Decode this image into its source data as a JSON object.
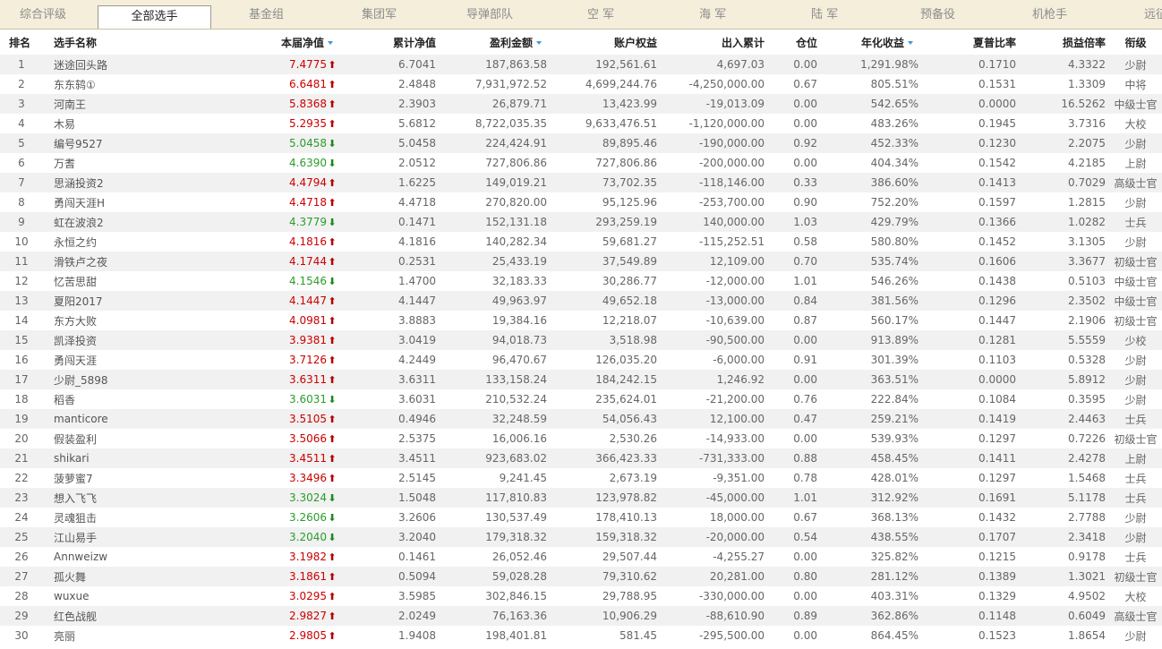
{
  "tabs": [
    "综合评级",
    "全部选手",
    "基金组",
    "集团军",
    "导弹部队",
    "空 军",
    "海 军",
    "陆 军",
    "预备役",
    "机枪手",
    "远征"
  ],
  "active_tab": 1,
  "headers": {
    "rank": "排名",
    "name": "选手名称",
    "nav": "本届净值",
    "cum_nav": "累计净值",
    "profit": "盈利金额",
    "equity": "账户权益",
    "flow": "出入累计",
    "position": "仓位",
    "annual": "年化收益",
    "sharpe": "夏普比率",
    "pl_ratio": "损益倍率",
    "grade": "衔级"
  },
  "colors": {
    "up": "#cc0000",
    "down": "#2a9d2a",
    "sort_indicator": "#3a9bd9",
    "row_alt": "#f1f1f1",
    "tabbar_bg": "#f4eedb"
  },
  "rows": [
    {
      "rank": "1",
      "name": "迷途回头路",
      "nav": "7.4775",
      "dir": "up",
      "cum_nav": "6.7041",
      "profit": "187,863.58",
      "equity": "192,561.61",
      "flow": "4,697.03",
      "position": "0.00",
      "annual": "1,291.98%",
      "sharpe": "0.1710",
      "pl_ratio": "4.3322",
      "grade": "少尉"
    },
    {
      "rank": "2",
      "name": "东东鸫①",
      "nav": "6.6481",
      "dir": "up",
      "cum_nav": "2.4848",
      "profit": "7,931,972.52",
      "equity": "4,699,244.76",
      "flow": "-4,250,000.00",
      "position": "0.67",
      "annual": "805.51%",
      "sharpe": "0.1531",
      "pl_ratio": "1.3309",
      "grade": "中将"
    },
    {
      "rank": "3",
      "name": "河南王",
      "nav": "5.8368",
      "dir": "up",
      "cum_nav": "2.3903",
      "profit": "26,879.71",
      "equity": "13,423.99",
      "flow": "-19,013.09",
      "position": "0.00",
      "annual": "542.65%",
      "sharpe": "0.0000",
      "pl_ratio": "16.5262",
      "grade": "中级士官"
    },
    {
      "rank": "4",
      "name": "木易",
      "nav": "5.2935",
      "dir": "up",
      "cum_nav": "5.6812",
      "profit": "8,722,035.35",
      "equity": "9,633,476.51",
      "flow": "-1,120,000.00",
      "position": "0.00",
      "annual": "483.26%",
      "sharpe": "0.1945",
      "pl_ratio": "3.7316",
      "grade": "大校"
    },
    {
      "rank": "5",
      "name": "编号9527",
      "nav": "5.0458",
      "dir": "down",
      "cum_nav": "5.0458",
      "profit": "224,424.91",
      "equity": "89,895.46",
      "flow": "-190,000.00",
      "position": "0.92",
      "annual": "452.33%",
      "sharpe": "0.1230",
      "pl_ratio": "2.2075",
      "grade": "少尉"
    },
    {
      "rank": "6",
      "name": "万耆",
      "nav": "4.6390",
      "dir": "down",
      "cum_nav": "2.0512",
      "profit": "727,806.86",
      "equity": "727,806.86",
      "flow": "-200,000.00",
      "position": "0.00",
      "annual": "404.34%",
      "sharpe": "0.1542",
      "pl_ratio": "4.2185",
      "grade": "上尉"
    },
    {
      "rank": "7",
      "name": "思涵投资2",
      "nav": "4.4794",
      "dir": "up",
      "cum_nav": "1.6225",
      "profit": "149,019.21",
      "equity": "73,702.35",
      "flow": "-118,146.00",
      "position": "0.33",
      "annual": "386.60%",
      "sharpe": "0.1413",
      "pl_ratio": "0.7029",
      "grade": "高级士官"
    },
    {
      "rank": "8",
      "name": "勇闯天涯H",
      "nav": "4.4718",
      "dir": "up",
      "cum_nav": "4.4718",
      "profit": "270,820.00",
      "equity": "95,125.96",
      "flow": "-253,700.00",
      "position": "0.90",
      "annual": "752.20%",
      "sharpe": "0.1597",
      "pl_ratio": "1.2815",
      "grade": "少尉"
    },
    {
      "rank": "9",
      "name": "虹在波浪2",
      "nav": "4.3779",
      "dir": "down",
      "cum_nav": "0.1471",
      "profit": "152,131.18",
      "equity": "293,259.19",
      "flow": "140,000.00",
      "position": "1.03",
      "annual": "429.79%",
      "sharpe": "0.1366",
      "pl_ratio": "1.0282",
      "grade": "士兵"
    },
    {
      "rank": "10",
      "name": "永恒之约",
      "nav": "4.1816",
      "dir": "up",
      "cum_nav": "4.1816",
      "profit": "140,282.34",
      "equity": "59,681.27",
      "flow": "-115,252.51",
      "position": "0.58",
      "annual": "580.80%",
      "sharpe": "0.1452",
      "pl_ratio": "3.1305",
      "grade": "少尉"
    },
    {
      "rank": "11",
      "name": "滑铁卢之夜",
      "nav": "4.1744",
      "dir": "up",
      "cum_nav": "0.2531",
      "profit": "25,433.19",
      "equity": "37,549.89",
      "flow": "12,109.00",
      "position": "0.70",
      "annual": "535.74%",
      "sharpe": "0.1606",
      "pl_ratio": "3.3677",
      "grade": "初级士官"
    },
    {
      "rank": "12",
      "name": "忆苦思甜",
      "nav": "4.1546",
      "dir": "down",
      "cum_nav": "1.4700",
      "profit": "32,183.33",
      "equity": "30,286.77",
      "flow": "-12,000.00",
      "position": "1.01",
      "annual": "546.26%",
      "sharpe": "0.1438",
      "pl_ratio": "0.5103",
      "grade": "中级士官"
    },
    {
      "rank": "13",
      "name": "夏阳2017",
      "nav": "4.1447",
      "dir": "up",
      "cum_nav": "4.1447",
      "profit": "49,963.97",
      "equity": "49,652.18",
      "flow": "-13,000.00",
      "position": "0.84",
      "annual": "381.56%",
      "sharpe": "0.1296",
      "pl_ratio": "2.3502",
      "grade": "中级士官"
    },
    {
      "rank": "14",
      "name": "东方大败",
      "nav": "4.0981",
      "dir": "up",
      "cum_nav": "3.8883",
      "profit": "19,384.16",
      "equity": "12,218.07",
      "flow": "-10,639.00",
      "position": "0.87",
      "annual": "560.17%",
      "sharpe": "0.1447",
      "pl_ratio": "2.1906",
      "grade": "初级士官"
    },
    {
      "rank": "15",
      "name": "凯泽投资",
      "nav": "3.9381",
      "dir": "up",
      "cum_nav": "3.0419",
      "profit": "94,018.73",
      "equity": "3,518.98",
      "flow": "-90,500.00",
      "position": "0.00",
      "annual": "913.89%",
      "sharpe": "0.1281",
      "pl_ratio": "5.5559",
      "grade": "少校"
    },
    {
      "rank": "16",
      "name": "勇闯天涯",
      "nav": "3.7126",
      "dir": "up",
      "cum_nav": "4.2449",
      "profit": "96,470.67",
      "equity": "126,035.20",
      "flow": "-6,000.00",
      "position": "0.91",
      "annual": "301.39%",
      "sharpe": "0.1103",
      "pl_ratio": "0.5328",
      "grade": "少尉"
    },
    {
      "rank": "17",
      "name": "少尉_5898",
      "nav": "3.6311",
      "dir": "up",
      "cum_nav": "3.6311",
      "profit": "133,158.24",
      "equity": "184,242.15",
      "flow": "1,246.92",
      "position": "0.00",
      "annual": "363.51%",
      "sharpe": "0.0000",
      "pl_ratio": "5.8912",
      "grade": "少尉"
    },
    {
      "rank": "18",
      "name": "稻香",
      "nav": "3.6031",
      "dir": "down",
      "cum_nav": "3.6031",
      "profit": "210,532.24",
      "equity": "235,624.01",
      "flow": "-21,200.00",
      "position": "0.76",
      "annual": "222.84%",
      "sharpe": "0.1084",
      "pl_ratio": "0.3595",
      "grade": "少尉"
    },
    {
      "rank": "19",
      "name": "manticore",
      "nav": "3.5105",
      "dir": "up",
      "cum_nav": "0.4946",
      "profit": "32,248.59",
      "equity": "54,056.43",
      "flow": "12,100.00",
      "position": "0.47",
      "annual": "259.21%",
      "sharpe": "0.1419",
      "pl_ratio": "2.4463",
      "grade": "士兵"
    },
    {
      "rank": "20",
      "name": "假装盈利",
      "nav": "3.5066",
      "dir": "up",
      "cum_nav": "2.5375",
      "profit": "16,006.16",
      "equity": "2,530.26",
      "flow": "-14,933.00",
      "position": "0.00",
      "annual": "539.93%",
      "sharpe": "0.1297",
      "pl_ratio": "0.7226",
      "grade": "初级士官"
    },
    {
      "rank": "21",
      "name": "shikari",
      "nav": "3.4511",
      "dir": "up",
      "cum_nav": "3.4511",
      "profit": "923,683.02",
      "equity": "366,423.33",
      "flow": "-731,333.00",
      "position": "0.88",
      "annual": "458.45%",
      "sharpe": "0.1411",
      "pl_ratio": "2.4278",
      "grade": "上尉"
    },
    {
      "rank": "22",
      "name": "菠萝蜜7",
      "nav": "3.3496",
      "dir": "up",
      "cum_nav": "2.5145",
      "profit": "9,241.45",
      "equity": "2,673.19",
      "flow": "-9,351.00",
      "position": "0.78",
      "annual": "428.01%",
      "sharpe": "0.1297",
      "pl_ratio": "1.5468",
      "grade": "士兵"
    },
    {
      "rank": "23",
      "name": "想入飞飞",
      "nav": "3.3024",
      "dir": "down",
      "cum_nav": "1.5048",
      "profit": "117,810.83",
      "equity": "123,978.82",
      "flow": "-45,000.00",
      "position": "1.01",
      "annual": "312.92%",
      "sharpe": "0.1691",
      "pl_ratio": "5.1178",
      "grade": "士兵"
    },
    {
      "rank": "24",
      "name": "灵魂狙击",
      "nav": "3.2606",
      "dir": "down",
      "cum_nav": "3.2606",
      "profit": "130,537.49",
      "equity": "178,410.13",
      "flow": "18,000.00",
      "position": "0.67",
      "annual": "368.13%",
      "sharpe": "0.1432",
      "pl_ratio": "2.7788",
      "grade": "少尉"
    },
    {
      "rank": "25",
      "name": "江山易手",
      "nav": "3.2040",
      "dir": "down",
      "cum_nav": "3.2040",
      "profit": "179,318.32",
      "equity": "159,318.32",
      "flow": "-20,000.00",
      "position": "0.54",
      "annual": "438.55%",
      "sharpe": "0.1707",
      "pl_ratio": "2.3418",
      "grade": "少尉"
    },
    {
      "rank": "26",
      "name": "Annweizw",
      "nav": "3.1982",
      "dir": "up",
      "cum_nav": "0.1461",
      "profit": "26,052.46",
      "equity": "29,507.44",
      "flow": "-4,255.27",
      "position": "0.00",
      "annual": "325.82%",
      "sharpe": "0.1215",
      "pl_ratio": "0.9178",
      "grade": "士兵"
    },
    {
      "rank": "27",
      "name": "孤火舞",
      "nav": "3.1861",
      "dir": "up",
      "cum_nav": "0.5094",
      "profit": "59,028.28",
      "equity": "79,310.62",
      "flow": "20,281.00",
      "position": "0.80",
      "annual": "281.12%",
      "sharpe": "0.1389",
      "pl_ratio": "1.3021",
      "grade": "初级士官"
    },
    {
      "rank": "28",
      "name": "wuxue",
      "nav": "3.0295",
      "dir": "up",
      "cum_nav": "3.5985",
      "profit": "302,846.15",
      "equity": "29,788.95",
      "flow": "-330,000.00",
      "position": "0.00",
      "annual": "403.31%",
      "sharpe": "0.1329",
      "pl_ratio": "4.9502",
      "grade": "大校"
    },
    {
      "rank": "29",
      "name": "红色战舰",
      "nav": "2.9827",
      "dir": "up",
      "cum_nav": "2.0249",
      "profit": "76,163.36",
      "equity": "10,906.29",
      "flow": "-88,610.90",
      "position": "0.89",
      "annual": "362.86%",
      "sharpe": "0.1148",
      "pl_ratio": "0.6049",
      "grade": "高级士官"
    },
    {
      "rank": "30",
      "name": "亮丽",
      "nav": "2.9805",
      "dir": "up",
      "cum_nav": "1.9408",
      "profit": "198,401.81",
      "equity": "581.45",
      "flow": "-295,500.00",
      "position": "0.00",
      "annual": "864.45%",
      "sharpe": "0.1523",
      "pl_ratio": "1.8654",
      "grade": "少尉"
    }
  ]
}
